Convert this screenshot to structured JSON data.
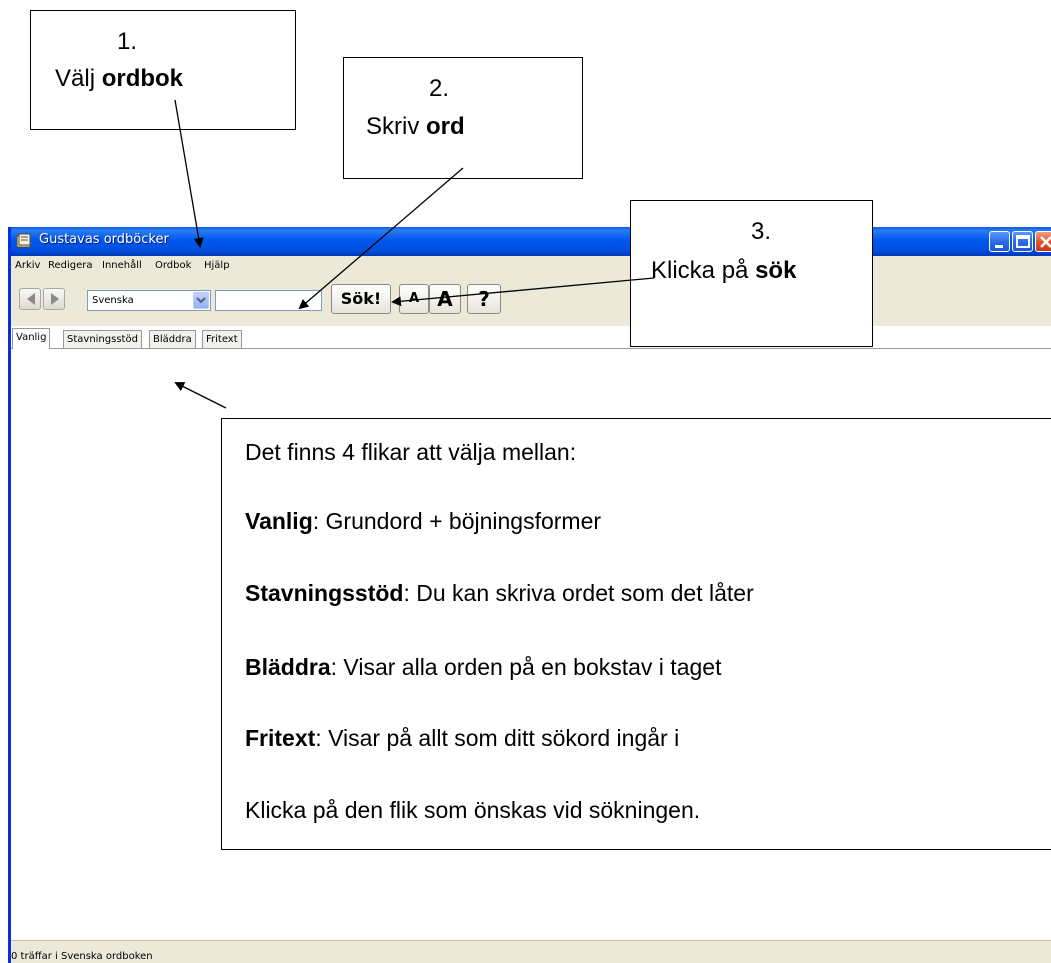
{
  "window": {
    "title": "Gustavas ordböcker",
    "menu": [
      "Arkiv",
      "Redigera",
      "Innehåll",
      "Ordbok",
      "Hjälp"
    ],
    "toolbar": {
      "dictionary_select": "Svenska",
      "search_value": "",
      "search_button": "Sök!",
      "font_small": "A",
      "font_large": "A",
      "help": "?"
    },
    "tabs": [
      "Vanlig",
      "Stavningsstöd",
      "Bläddra",
      "Fritext"
    ],
    "status": "0 träffar i Svenska ordboken"
  },
  "annotations": {
    "step1": {
      "number": "1.",
      "text": "Välj ",
      "bold": "ordbok"
    },
    "step2": {
      "number": "2.",
      "text": "Skriv ",
      "bold": "ord"
    },
    "step3": {
      "number": "3.",
      "text": "Klicka på ",
      "bold": "sök"
    },
    "info": {
      "intro": "Det finns 4 flikar att välja mellan:",
      "items": [
        {
          "term": "Vanlig",
          "desc": ": Grundord + böjningsformer"
        },
        {
          "term": "Stavningsstöd",
          "desc": ": Du kan skriva ordet som det låter"
        },
        {
          "term": "Bläddra",
          "desc": ": Visar alla orden på en bokstav i taget"
        },
        {
          "term": "Fritext",
          "desc": ": Visar på allt som ditt sökord ingår i"
        }
      ],
      "outro": "Klicka på den flik som önskas vid sökningen."
    }
  }
}
